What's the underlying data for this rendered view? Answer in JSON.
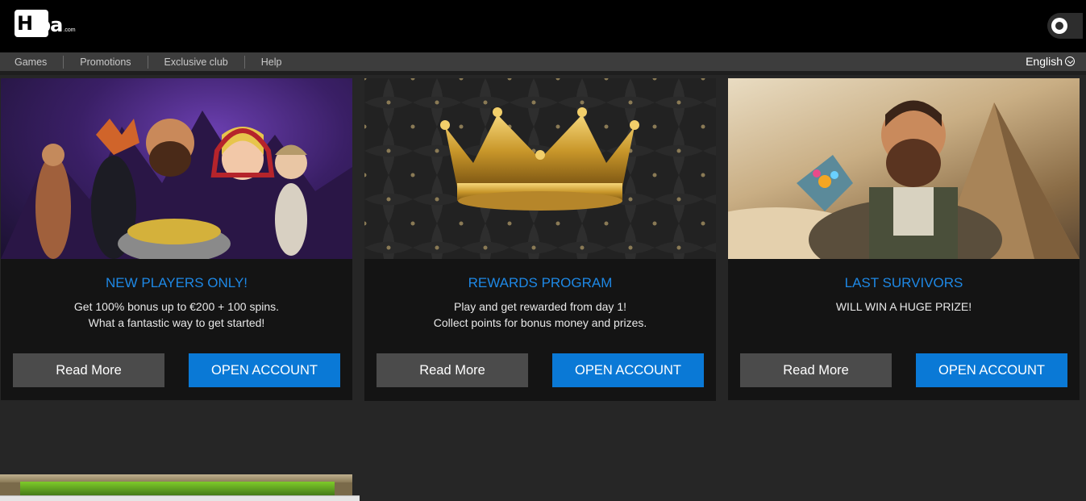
{
  "header": {
    "logo_main": "H",
    "logo_rest": "pa",
    "logo_suffix": ".com",
    "support_icon": "headset-icon"
  },
  "nav": {
    "items": [
      {
        "label": "Games"
      },
      {
        "label": "Promotions"
      },
      {
        "label": "Exclusive club"
      },
      {
        "label": "Help"
      }
    ],
    "language": "English",
    "language_icon": "chevron-down-circle-icon"
  },
  "cards": [
    {
      "title": "NEW PLAYERS ONLY!",
      "lines": [
        "Get 100% bonus up to €200 + 100 spins.",
        "What a fantastic way to get started!"
      ],
      "read_more": "Read More",
      "open_account": "OPEN ACCOUNT"
    },
    {
      "title": "REWARDS PROGRAM",
      "lines": [
        "Play and get rewarded from day 1!",
        "Collect points for bonus money and prizes."
      ],
      "read_more": "Read More",
      "open_account": "OPEN ACCOUNT"
    },
    {
      "title": "LAST SURVIVORS",
      "lines": [
        "WILL WIN A HUGE PRIZE!"
      ],
      "read_more": "Read More",
      "open_account": "OPEN ACCOUNT"
    }
  ],
  "colors": {
    "accent": "#1e88e5",
    "button_primary": "#0a79d6",
    "button_secondary": "#4b4b4b",
    "background": "#262626"
  }
}
